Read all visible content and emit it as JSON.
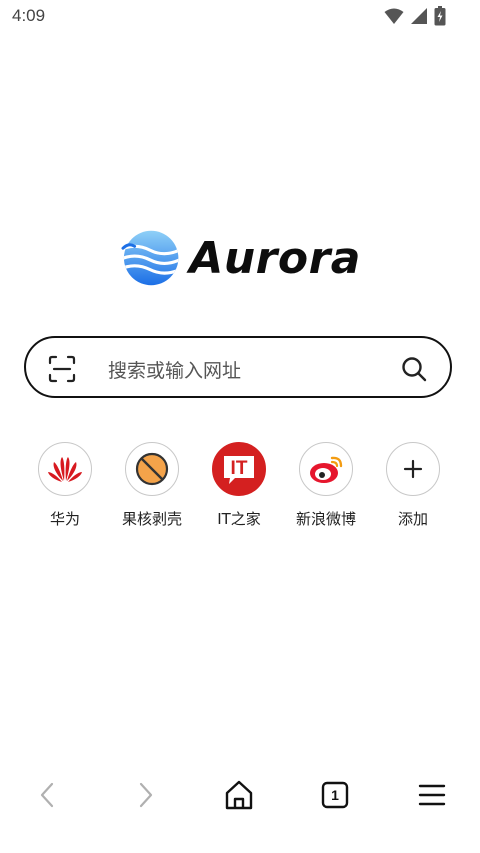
{
  "status_bar": {
    "time": "4:09",
    "icons": [
      "wifi-icon",
      "cellular-signal-icon",
      "battery-charging-icon"
    ]
  },
  "logo": {
    "text": "Aurora",
    "colors": {
      "mark_top": "#7cc6f5",
      "mark_bottom": "#1e73e8",
      "text": "#0d0d0d"
    }
  },
  "search": {
    "placeholder": "搜索或输入网址",
    "left_icon": "scan-icon",
    "right_icon": "search-icon"
  },
  "shortcuts": [
    {
      "label": "华为",
      "icon": "huawei-logo-icon"
    },
    {
      "label": "果核剥壳",
      "icon": "guohe-logo-icon"
    },
    {
      "label": "IT之家",
      "icon": "ithome-logo-icon",
      "icon_text": "IT"
    },
    {
      "label": "新浪微博",
      "icon": "weibo-logo-icon"
    },
    {
      "label": "添加",
      "icon": "plus-icon"
    }
  ],
  "bottom_nav": {
    "items": [
      "back-icon",
      "forward-icon",
      "home-icon",
      "tabs-icon",
      "menu-icon"
    ],
    "tabs_count": "1",
    "disabled_color": "#b0b0b0",
    "active_color": "#111111"
  }
}
